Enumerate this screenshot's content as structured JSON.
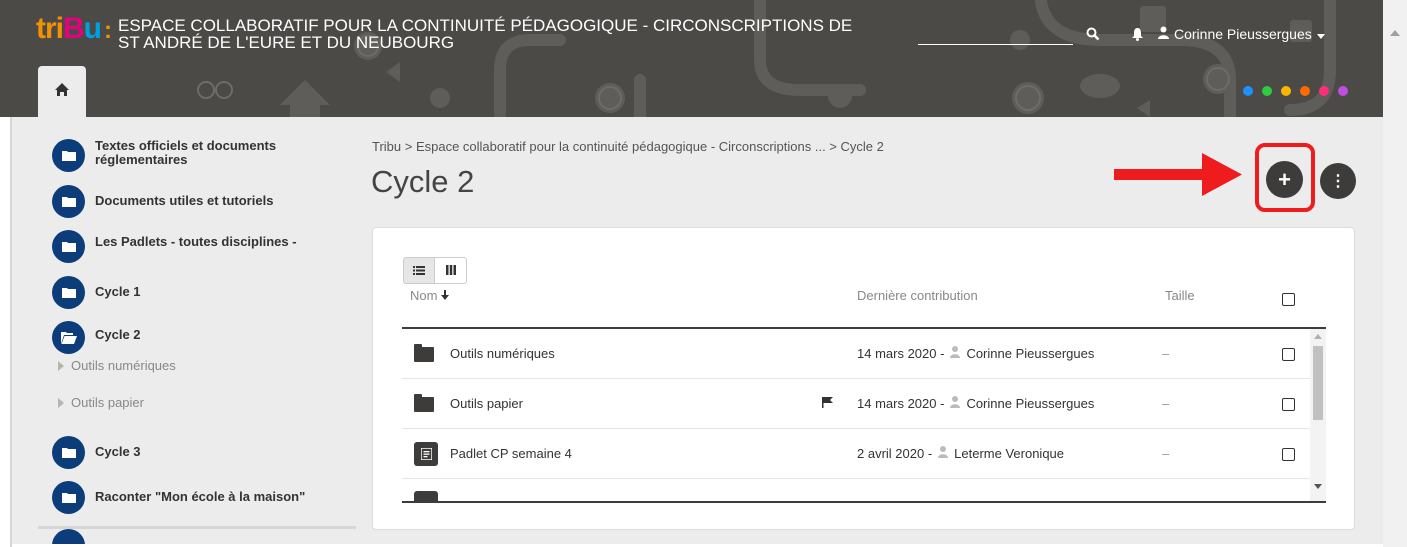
{
  "header": {
    "logo_parts": [
      "tri",
      "B",
      "u",
      ":"
    ],
    "site_title_line1": "ESPACE COLLABORATIF POUR LA CONTINUITÉ PÉDAGOGIQUE - CIRCONSCRIPTIONS DE",
    "site_title_line2": "ST ANDRÉ DE L'EURE ET DU NEUBOURG",
    "user_name": "Corinne Pieussergues",
    "icons": [
      "search-icon",
      "bell-icon",
      "user-icon",
      "chevron-down-icon",
      "home-icon"
    ],
    "color_dots": [
      "#1e90ff",
      "#2ecc40",
      "#ffb400",
      "#ff6a00",
      "#ff2d7a",
      "#c04ee0"
    ]
  },
  "sidebar": {
    "items": [
      {
        "label_line1": "Textes officiels et documents",
        "label_line2": "réglementaires"
      },
      {
        "label": "Documents utiles et tutoriels"
      },
      {
        "label": "Les Padlets - toutes disciplines -"
      },
      {
        "label": "Cycle 1"
      },
      {
        "label": "Cycle 2"
      },
      {
        "label": "Cycle 3"
      },
      {
        "label": "Raconter \"Mon école à la maison\""
      }
    ],
    "subitems": [
      "Outils numériques",
      "Outils papier"
    ]
  },
  "main": {
    "breadcrumb": "Tribu > Espace collaboratif pour la continuité pédagogique - Circonscriptions ... > Cycle 2",
    "page_title": "Cycle 2",
    "add_label": "+",
    "more_label": "⋮"
  },
  "table": {
    "columns": {
      "name": "Nom",
      "contribution": "Dernière contribution",
      "size": "Taille"
    },
    "rows": [
      {
        "name": "Outils numériques",
        "date": "14 mars 2020 -",
        "author": "Corinne Pieussergues",
        "size": "–",
        "type": "folder",
        "flag": false
      },
      {
        "name": "Outils papier",
        "date": "14 mars 2020 -",
        "author": "Corinne Pieussergues",
        "size": "–",
        "type": "folder",
        "flag": true
      },
      {
        "name": "Padlet CP semaine 4",
        "date": "2 avril 2020 -",
        "author": "Leterme Veronique",
        "size": "–",
        "type": "document",
        "flag": false
      }
    ]
  },
  "colors": {
    "header_bg": "#4b4a47",
    "accent_navy": "#0c3d7a",
    "highlight_red": "#ee1c1c",
    "button_dark": "#3d3c3a"
  }
}
